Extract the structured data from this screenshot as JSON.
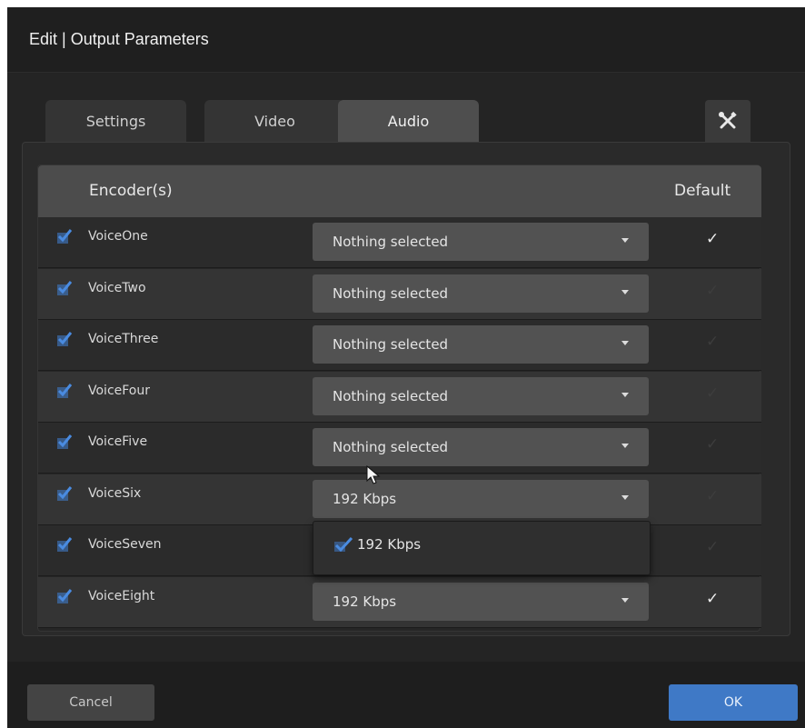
{
  "dialog": {
    "title": "Edit | Output Parameters"
  },
  "tabs": [
    {
      "label": "Settings",
      "active": false
    },
    {
      "label": "Video",
      "active": false
    },
    {
      "label": "Audio",
      "active": true
    }
  ],
  "tools": {
    "icon": "wrench-screwdriver-icon"
  },
  "table": {
    "headers": {
      "encoder": "Encoder(s)",
      "default": "Default"
    },
    "rows": [
      {
        "name": "VoiceOne",
        "checked": true,
        "selection": "Nothing selected",
        "default": true
      },
      {
        "name": "VoiceTwo",
        "checked": true,
        "selection": "Nothing selected",
        "default": false
      },
      {
        "name": "VoiceThree",
        "checked": true,
        "selection": "Nothing selected",
        "default": false
      },
      {
        "name": "VoiceFour",
        "checked": true,
        "selection": "Nothing selected",
        "default": false
      },
      {
        "name": "VoiceFive",
        "checked": true,
        "selection": "Nothing selected",
        "default": false
      },
      {
        "name": "VoiceSix",
        "checked": true,
        "selection": "192 Kbps",
        "default": false
      },
      {
        "name": "VoiceSeven",
        "checked": true,
        "selection": "",
        "default": false
      },
      {
        "name": "VoiceEight",
        "checked": true,
        "selection": "192 Kbps",
        "default": true
      }
    ]
  },
  "dropdown": {
    "options": [
      {
        "label": "192 Kbps",
        "checked": true
      }
    ]
  },
  "check_glyph": "✓",
  "footer": {
    "cancel_label": "Cancel",
    "ok_label": "OK"
  },
  "colors": {
    "checkbox_blue": "#3f79c6",
    "ok_button": "#3f79c6",
    "header_bg": "#4c4c4c"
  }
}
